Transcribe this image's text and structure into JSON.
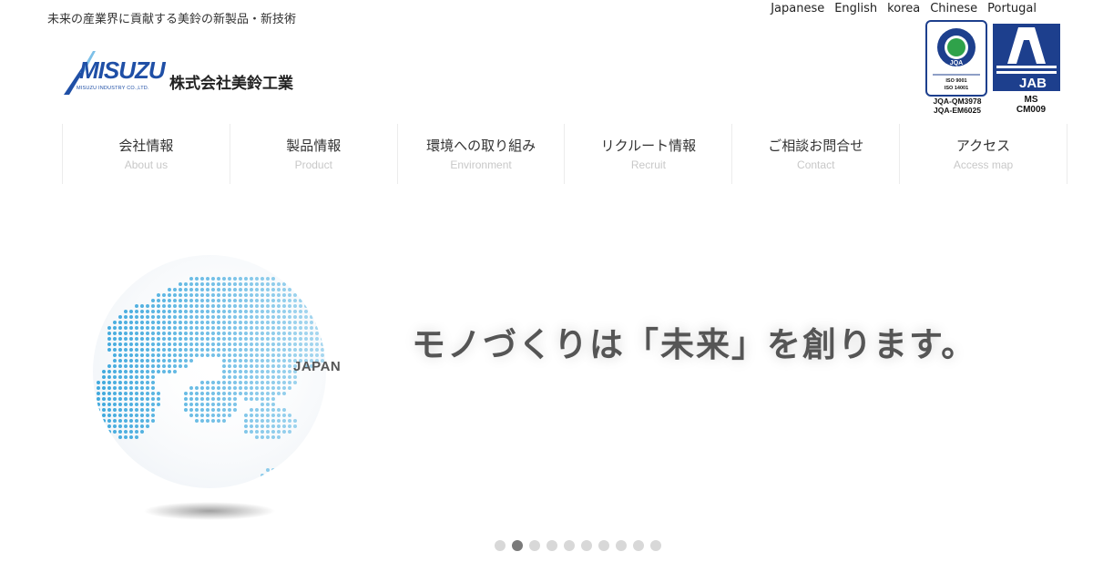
{
  "header": {
    "tagline": "未来の産業界に貢献する美鈴の新製品・新技術",
    "logo": {
      "wordmark": "MISUZU",
      "subtitle": "MISUZU INDUSTRY CO.,LTD.",
      "company_name": "株式会社美鈴工業"
    },
    "languages": [
      "Japanese",
      "English",
      "korea",
      "Chinese",
      "Portugal"
    ],
    "certifications": {
      "jqa": {
        "label": "JQA",
        "codes": [
          "ISO 9001",
          "ISO 14001"
        ],
        "numbers": [
          "JQA-QM3978",
          "JQA-EM6025"
        ]
      },
      "jab": {
        "label": "JAB",
        "numbers": [
          "MS",
          "CM009"
        ]
      }
    }
  },
  "nav": [
    {
      "jp": "会社情報",
      "en": "About us"
    },
    {
      "jp": "製品情報",
      "en": "Product"
    },
    {
      "jp": "環境への取り組み",
      "en": "Environment"
    },
    {
      "jp": "リクルート情報",
      "en": "Recruit"
    },
    {
      "jp": "ご相談お問合せ",
      "en": "Contact"
    },
    {
      "jp": "アクセス",
      "en": "Access map"
    }
  ],
  "hero": {
    "region_label": "JAPAN",
    "headline": "モノづくりは「未来」を創ります。"
  },
  "slider": {
    "total": 10,
    "active": 2
  },
  "colors": {
    "brand_blue": "#1f4fa6",
    "globe_blue": "#3aa3dd",
    "dot_active": "#7a7a7a",
    "dot_inactive": "#d8d8d8"
  }
}
